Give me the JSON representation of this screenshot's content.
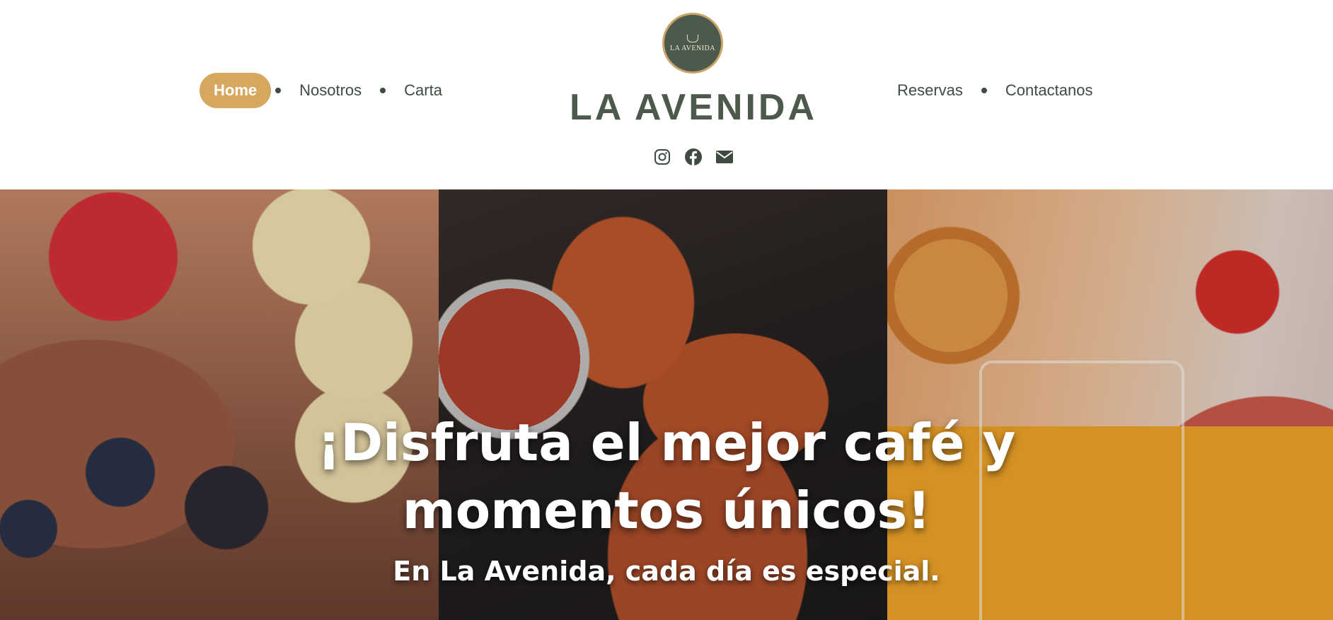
{
  "nav": {
    "left": [
      {
        "label": "Home",
        "active": true
      },
      {
        "label": "Nosotros",
        "active": false
      },
      {
        "label": "Carta",
        "active": false
      }
    ],
    "right": [
      {
        "label": "Reservas",
        "active": false
      },
      {
        "label": "Contactanos",
        "active": false
      }
    ]
  },
  "brand": {
    "logo_text": "LA AVENIDA",
    "name": "LA AVENIDA"
  },
  "social": [
    "instagram-icon",
    "facebook-icon",
    "email-icon"
  ],
  "hero": {
    "headline_line1": "¡Disfruta el mejor café y",
    "headline_line2": "momentos únicos!",
    "subheadline": "En La Avenida, cada día es especial."
  },
  "colors": {
    "accent": "#d6a75f",
    "brand_green": "#4b5a4b",
    "nav_text": "#3f4b41"
  }
}
